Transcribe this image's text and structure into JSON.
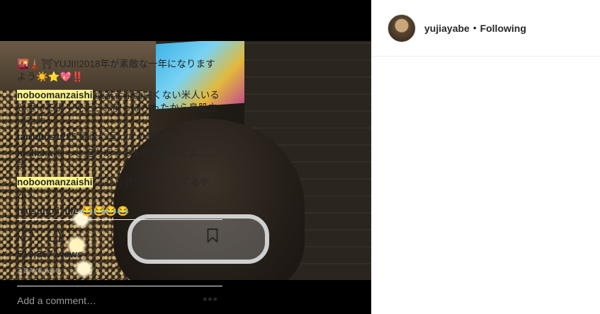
{
  "post": {
    "username": "yujiayabe",
    "follow_status": "Following",
    "separator": "•",
    "caption_user": "",
    "caption_text": "🌇🗼⛩YUJI!!2018年が素敵な一年になりますよう☀️⭐💖‼️",
    "comments": [
      {
        "user": "noboomanzaishi",
        "highlight": true,
        "text": "滅茶苦茶面白くない米人いると思ってよく見たらお前っぽかったから鳥肌立ったわー"
      },
      {
        "user": "tarontos1225",
        "highlight": false,
        "text": "最後に写ったの俺か？"
      },
      {
        "user": "molicka",
        "highlight": false,
        "text": "もっと迫力あるのを想像してたよ。。。笑"
      },
      {
        "user": "noboomanzaishi",
        "highlight": true,
        "text": "芯からセンス無くしてるやん！"
      },
      {
        "user": "natsuholi_life",
        "highlight": false,
        "text": "😂😂😂😂"
      }
    ],
    "views": "519,367 views",
    "time_ago": "3 DAYS AGO",
    "add_comment_placeholder": "Add a comment…",
    "more_label": "•••"
  },
  "icons": {
    "like": "heart-icon",
    "comment": "comment-bubble-icon",
    "save": "bookmark-icon",
    "more": "more-options-icon"
  }
}
